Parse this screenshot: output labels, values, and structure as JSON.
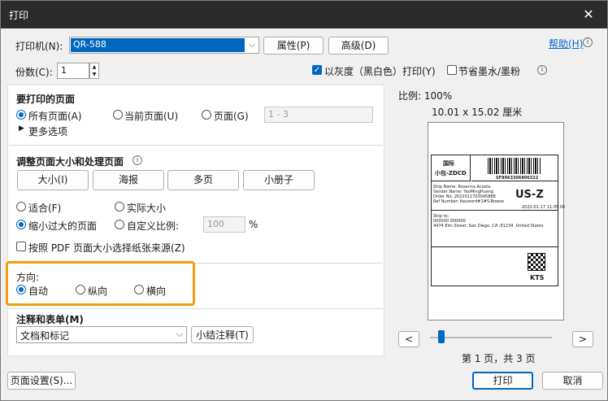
{
  "window": {
    "title": "打印",
    "close": "✕"
  },
  "printer": {
    "label": "打印机(N):",
    "value": "QR-588",
    "properties": "属性(P)",
    "advanced": "高级(D)"
  },
  "help": "帮助(H)",
  "copies": {
    "label": "份数(C):",
    "value": "1"
  },
  "grayscale": {
    "label": "以灰度（黑白色）打印(Y)",
    "checked": true
  },
  "save_ink": {
    "label": "节省墨水/墨粉",
    "checked": false
  },
  "pages_section": {
    "title": "要打印的页面",
    "all": "所有页面(A)",
    "current": "当前页面(U)",
    "pages": "页面(G)",
    "pages_placeholder": "1 - 3",
    "more": "更多选项"
  },
  "sizing_section": {
    "title": "调整页面大小和处理页面",
    "tabs": [
      "大小(I)",
      "海报",
      "多页",
      "小册子"
    ],
    "fit": "适合(F)",
    "actual": "实际大小",
    "shrink": "缩小过大的页面",
    "custom": "自定义比例:",
    "custom_value": "100",
    "percent": "%",
    "choose_source": "按照 PDF 页面大小选择纸张来源(Z)"
  },
  "orientation": {
    "title": "方向:",
    "auto": "自动",
    "portrait": "纵向",
    "landscape": "横向"
  },
  "comments": {
    "title": "注释和表单(M)",
    "value": "文档和标记",
    "summarize": "小结注释(T)"
  },
  "preview": {
    "scale": "比例:  100%",
    "size": "10.01 x 15.02 厘米",
    "page_info": "第 1 页，共 3 页",
    "prev": "<",
    "next": ">",
    "label": {
      "brand": "国际",
      "brand2": "小包-ZDCD",
      "tracking": "SF8963306806322",
      "line1": "Ship Name: Rosanna Acosta",
      "line2": "Sender Name: YaoMingHuang",
      "line3": "Order No: 2022011703045888",
      "line4": "Ref Number: Keyword#1#S-Bowse",
      "code": "US-Z",
      "date": "2022-01-17 11:05:00",
      "ship_to": "Ship to:",
      "zip": "000000 000000",
      "addr": "4474 Elm Street ,San Diego ,CA ,81234 ,United States",
      "carrier": "KTS"
    }
  },
  "footer": {
    "page_setup": "页面设置(S)...",
    "print": "打印",
    "cancel": "取消"
  },
  "colors": {
    "accent": "#0067c0",
    "highlight": "#f39c12",
    "titlebar": "#2b2b2b"
  }
}
